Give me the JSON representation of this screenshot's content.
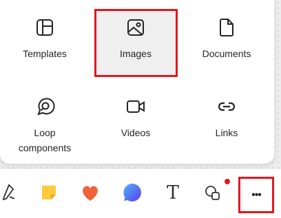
{
  "menu": {
    "items": [
      {
        "label": "Templates",
        "icon": "templates-icon"
      },
      {
        "label": "Images",
        "icon": "image-icon"
      },
      {
        "label": "Documents",
        "icon": "document-icon"
      },
      {
        "label": "Loop components",
        "icon": "loop-icon"
      },
      {
        "label": "Videos",
        "icon": "video-icon"
      },
      {
        "label": "Links",
        "icon": "link-icon"
      }
    ]
  },
  "toolbar": {
    "items": [
      {
        "name": "pen",
        "icon": "pen-icon"
      },
      {
        "name": "sticky-note",
        "icon": "sticky-note-icon"
      },
      {
        "name": "reactions",
        "icon": "heart-icon"
      },
      {
        "name": "comment",
        "icon": "comment-icon"
      },
      {
        "name": "text",
        "icon": "text-icon",
        "glyph": "T"
      },
      {
        "name": "shapes",
        "icon": "shapes-icon"
      },
      {
        "name": "more",
        "icon": "more-icon",
        "glyph": "•••"
      }
    ]
  },
  "colors": {
    "highlight": "#e3161f",
    "sticky": "#ffc83d",
    "heart": "#f1613a",
    "comment": "#3b6ef5"
  }
}
